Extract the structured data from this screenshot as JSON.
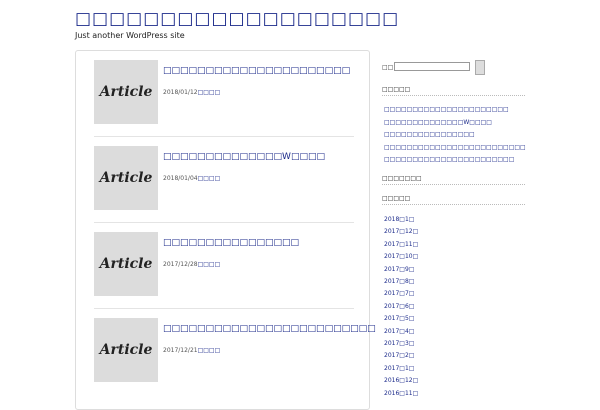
{
  "site": {
    "title": "□□□□□□□□□□□□□□□□□□□",
    "tagline": "Just another WordPress site"
  },
  "articles": [
    {
      "thumb": "Article",
      "title": "□□□□□□□□□□□□□□□□□□□□□□",
      "date": "2018/01/12",
      "category": "□□□□"
    },
    {
      "thumb": "Article",
      "title": "□□□□□□□□□□□□□□W□□□□",
      "date": "2018/01/04",
      "category": "□□□□"
    },
    {
      "thumb": "Article",
      "title": "□□□□□□□□□□□□□□□□",
      "date": "2017/12/28",
      "category": "□□□□"
    },
    {
      "thumb": "Article",
      "title": "□□□□□□□□□□□□□□□□□□□□□□□□□",
      "date": "2017/12/21",
      "category": "□□□□"
    }
  ],
  "sidebar": {
    "search_label": "□□:",
    "recent_title": "□□□□□",
    "recent": [
      "□□□□□□□□□□□□□□□□□□□□□□",
      "□□□□□□□□□□□□□□W□□□□",
      "□□□□□□□□□□□□□□□□",
      "□□□□□□□□□□□□□□□□□□□□□□□□□",
      "□□□□□□□□□□□□□□□□□□□□□□□"
    ],
    "comments_title": "□□□□□□□",
    "archive_title": "□□□□□",
    "archives": [
      "2018□1□",
      "2017□12□",
      "2017□11□",
      "2017□10□",
      "2017□9□",
      "2017□8□",
      "2017□7□",
      "2017□6□",
      "2017□5□",
      "2017□4□",
      "2017□3□",
      "2017□2□",
      "2017□1□",
      "2016□12□",
      "2016□11□"
    ]
  }
}
